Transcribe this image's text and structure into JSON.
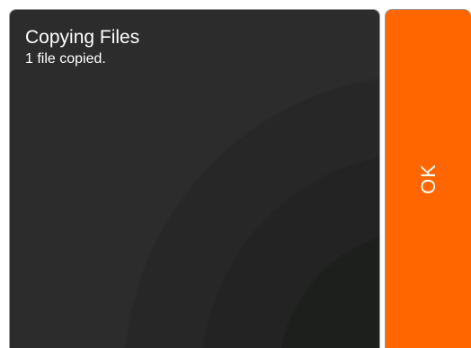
{
  "dialog": {
    "title": "Copying Files",
    "message": "1 file copied.",
    "ok_label": "OK"
  },
  "colors": {
    "panel_background": "#2b2c2b",
    "accent": "#ff6600",
    "text": "#ffffff"
  }
}
